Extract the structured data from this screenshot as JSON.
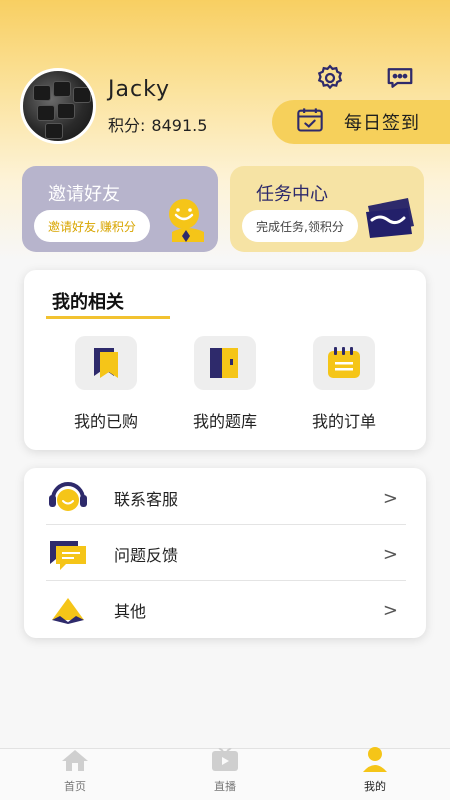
{
  "user": {
    "name": "Jacky",
    "points_label": "积分:",
    "points_value": "8491.5"
  },
  "header": {
    "signin_label": "每日签到",
    "icons": [
      "settings-icon",
      "message-icon",
      "calendar-check-icon"
    ]
  },
  "cards": {
    "invite": {
      "title": "邀请好友",
      "subtitle": "邀请好友,赚积分"
    },
    "task": {
      "title": "任务中心",
      "subtitle": "完成任务,领积分"
    }
  },
  "related": {
    "title": "我的相关",
    "items": [
      {
        "label": "我的已购",
        "icon": "bookmark-icon"
      },
      {
        "label": "我的题库",
        "icon": "book-icon"
      },
      {
        "label": "我的订单",
        "icon": "calendar-icon"
      }
    ]
  },
  "list": {
    "items": [
      {
        "label": "联系客服",
        "icon": "headset-icon"
      },
      {
        "label": "问题反馈",
        "icon": "chat-icon"
      },
      {
        "label": "其他",
        "icon": "other-icon"
      }
    ],
    "chevron": ">"
  },
  "tabbar": {
    "tabs": [
      {
        "label": "首页",
        "icon": "home-icon"
      },
      {
        "label": "直播",
        "icon": "tv-icon"
      },
      {
        "label": "我的",
        "icon": "user-icon"
      }
    ]
  },
  "colors": {
    "accent": "#f2c230",
    "navy": "#2e2a6b",
    "invite_card": "#b7b4cc",
    "task_card": "#f6e3a4"
  }
}
